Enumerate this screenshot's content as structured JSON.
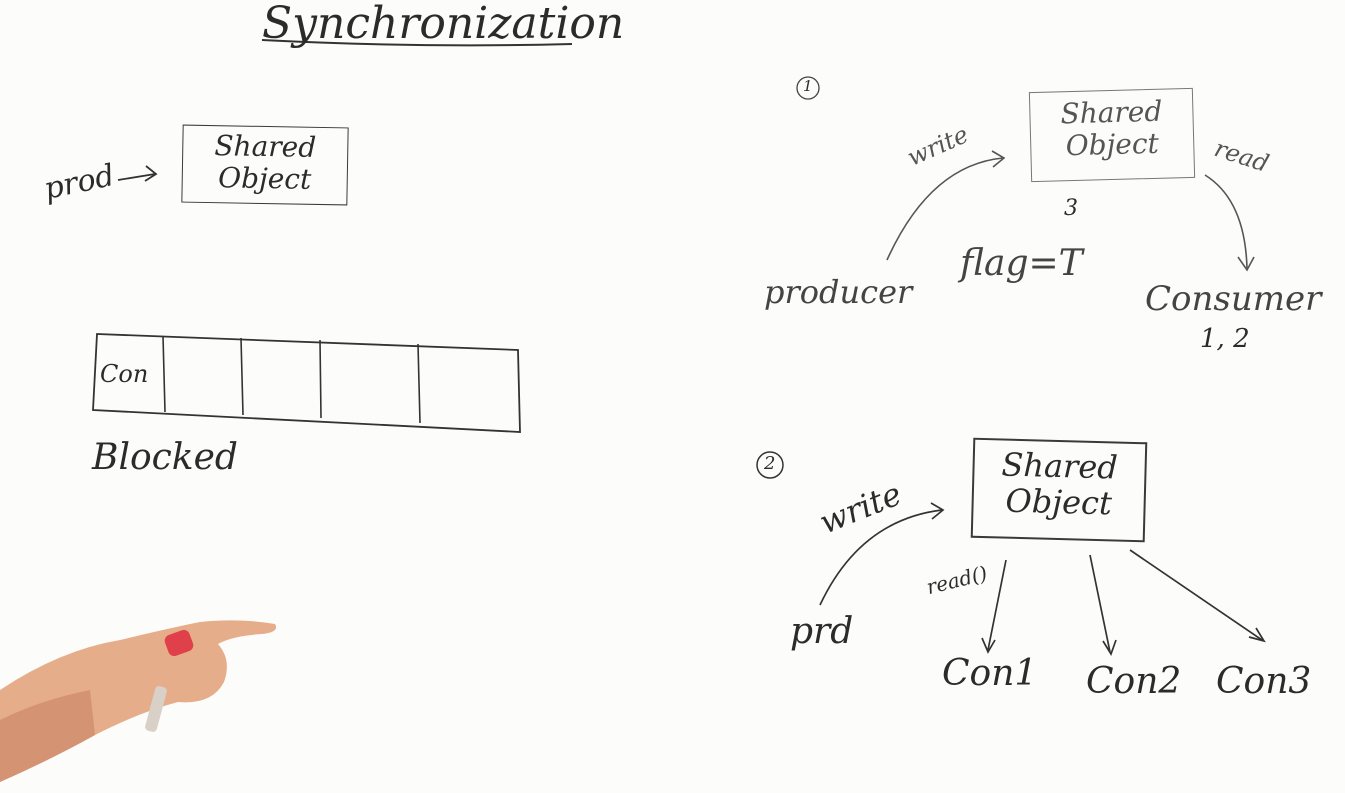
{
  "title": "Synchronization",
  "left": {
    "prod_label": "prod",
    "shared_object": [
      "Shared",
      "Object"
    ],
    "queue_first_cell": "Con",
    "blocked_label": "Blocked"
  },
  "scenario1": {
    "number": "1",
    "write_label": "write",
    "read_label": "read",
    "shared_object": [
      "Shared",
      "Object"
    ],
    "value": "3",
    "flag": "flag=T",
    "producer": "producer",
    "consumer": "Consumer",
    "consumer_values": "1, 2"
  },
  "scenario2": {
    "number": "2",
    "write_label": "write",
    "read_label": "read()",
    "shared_object": [
      "Shared",
      "Object"
    ],
    "producer": "prd",
    "consumers": [
      "Con1",
      "Con2",
      "Con3"
    ]
  },
  "colors": {
    "board": "#fcfcfa",
    "ink": "#2b2b2b",
    "marker": "#e0404a",
    "hand": "#e9b08f"
  }
}
